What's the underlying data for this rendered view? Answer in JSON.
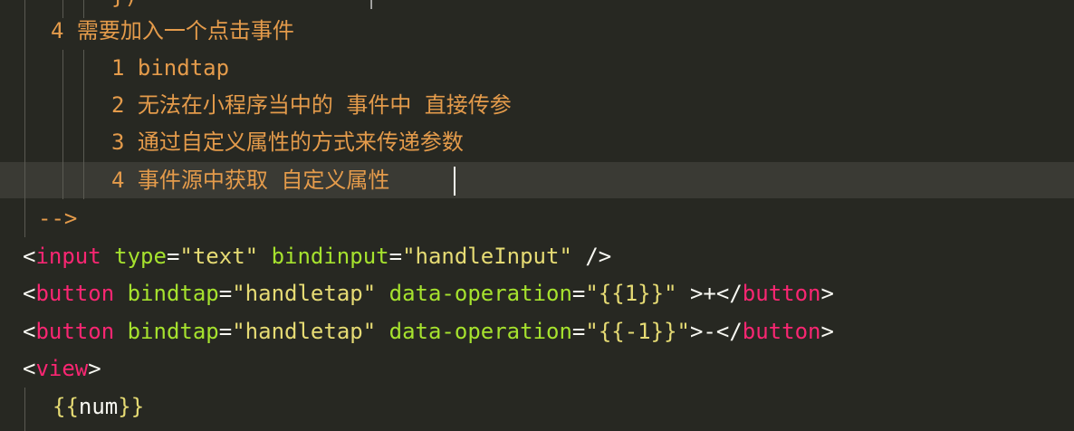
{
  "editor": {
    "comment": {
      "top_fragment": "})",
      "item4_heading": "4 需要加入一个点击事件",
      "sub_items": [
        "1 bindtap",
        "2 无法在小程序当中的 事件中 直接传参",
        "3 通过自定义属性的方式来传递参数",
        "4 事件源中获取 自定义属性"
      ],
      "close": "-->"
    },
    "code": {
      "line1": {
        "open": "<",
        "tag": "input",
        "attr1": "type",
        "eq1": "=",
        "val1": "\"text\"",
        "attr2": "bindinput",
        "eq2": "=",
        "val2": "\"handleInput\"",
        "close": " />"
      },
      "line2": {
        "open": "<",
        "tag": "button",
        "attr1": "bindtap",
        "eq1": "=",
        "val1": "\"handletap\"",
        "attr2": "data-operation",
        "eq2": "=",
        "val2": "\"{{1}}\"",
        "text": " >+",
        "close_open": "</",
        "close_tag": "button",
        "close_end": ">"
      },
      "line3": {
        "open": "<",
        "tag": "button",
        "attr1": "bindtap",
        "eq1": "=",
        "val1": "\"handletap\"",
        "attr2": "data-operation",
        "eq2": "=",
        "val2": "\"{{-1}}\"",
        "text": ">-",
        "close_open": "</",
        "close_tag": "button",
        "close_end": ">"
      },
      "line4": {
        "open": "<",
        "tag": "view",
        "close": ">"
      },
      "line5": {
        "open_braces": "{{",
        "var": "num",
        "close_braces": "}}"
      }
    }
  },
  "colors": {
    "background": "#272822",
    "comment": "#e49b4b",
    "tag": "#f92672",
    "attribute": "#a6e22e",
    "string": "#e6db74",
    "active_line": "#3a3a34"
  }
}
